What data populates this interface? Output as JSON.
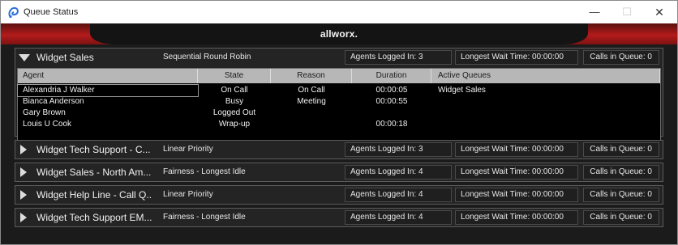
{
  "window": {
    "title": "Queue Status",
    "minimize_glyph": "—",
    "maximize_glyph": "☐",
    "close_glyph": "✕",
    "app_icon": "allworx-swirl-icon"
  },
  "brand": {
    "text": "allworx."
  },
  "colors": {
    "brand_red": "#b31b1b",
    "background": "#1b1b1b",
    "table_header": "#b7b7b7"
  },
  "columns": {
    "agent": "Agent",
    "state": "State",
    "reason": "Reason",
    "duration": "Duration",
    "active_queues": "Active Queues"
  },
  "queues": [
    {
      "name": "Widget Sales",
      "strategy": "Sequential Round Robin",
      "expanded": true,
      "agents_logged_in": "Agents Logged In: 3",
      "longest_wait": "Longest Wait Time: 00:00:00",
      "calls_in_queue": "Calls in Queue: 0",
      "agents": [
        {
          "agent": "Alexandria J Walker",
          "state": "On Call",
          "reason": "On Call",
          "duration": "00:00:05",
          "active_queues": "Widget Sales",
          "selected": true
        },
        {
          "agent": "Bianca Anderson",
          "state": "Busy",
          "reason": "Meeting",
          "duration": "00:00:55",
          "active_queues": ""
        },
        {
          "agent": "Gary Brown",
          "state": "Logged Out",
          "reason": "",
          "duration": "",
          "active_queues": ""
        },
        {
          "agent": "Louis U Cook",
          "state": "Wrap-up",
          "reason": "",
          "duration": "00:00:18",
          "active_queues": ""
        }
      ]
    },
    {
      "name": "Widget Tech Support - C...",
      "strategy": "Linear Priority",
      "expanded": false,
      "agents_logged_in": "Agents Logged In: 3",
      "longest_wait": "Longest Wait Time: 00:00:00",
      "calls_in_queue": "Calls in Queue: 0"
    },
    {
      "name": "Widget Sales - North Am...",
      "strategy": "Fairness - Longest Idle",
      "expanded": false,
      "agents_logged_in": "Agents Logged In: 4",
      "longest_wait": "Longest Wait Time: 00:00:00",
      "calls_in_queue": "Calls in Queue: 0"
    },
    {
      "name": "Widget Help Line - Call Q...",
      "strategy": "Linear Priority",
      "expanded": false,
      "agents_logged_in": "Agents Logged In: 4",
      "longest_wait": "Longest Wait Time: 00:00:00",
      "calls_in_queue": "Calls in Queue: 0"
    },
    {
      "name": "Widget Tech Support EM...",
      "strategy": "Fairness - Longest Idle",
      "expanded": false,
      "agents_logged_in": "Agents Logged In: 4",
      "longest_wait": "Longest Wait Time: 00:00:00",
      "calls_in_queue": "Calls in Queue: 0"
    }
  ]
}
